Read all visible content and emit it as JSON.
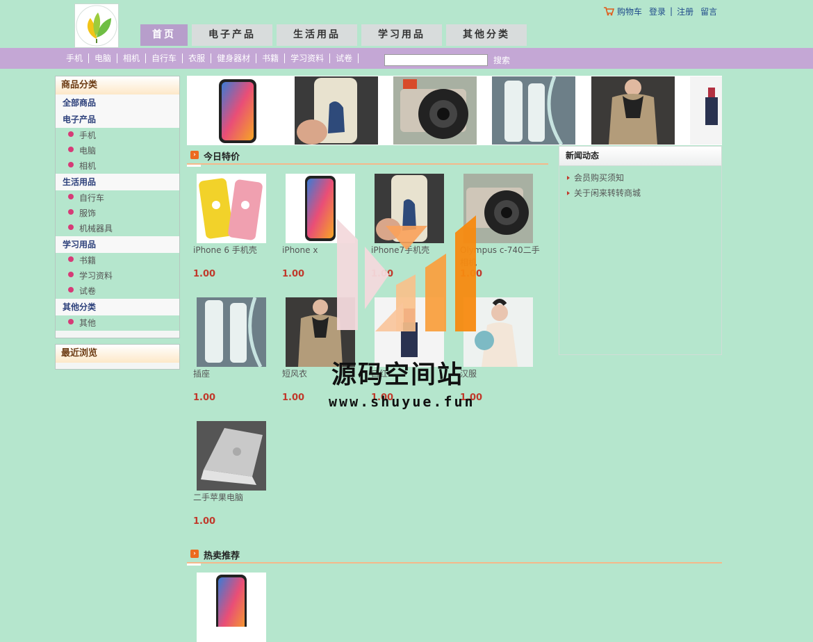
{
  "header": {
    "cart_label": "购物车",
    "login_label": "登录",
    "separator": "|",
    "register_label": "注册",
    "message_label": "留言"
  },
  "main_nav": {
    "tabs": [
      {
        "label": "首页",
        "active": true
      },
      {
        "label": "电子产品"
      },
      {
        "label": "生活用品"
      },
      {
        "label": "学习用品"
      },
      {
        "label": "其他分类"
      }
    ]
  },
  "sub_nav": {
    "items": [
      "手机",
      "电脑",
      "相机",
      "自行车",
      "衣服",
      "健身器材",
      "书籍",
      "学习资料",
      "试卷"
    ],
    "search_value": "",
    "search_button": "搜索"
  },
  "sidebar": {
    "title": "商品分类",
    "all_label": "全部商品",
    "groups": [
      {
        "name": "电子产品",
        "items": [
          "手机",
          "电脑",
          "相机"
        ]
      },
      {
        "name": "生活用品",
        "items": [
          "自行车",
          "服饰",
          "机械器具"
        ]
      },
      {
        "name": "学习用品",
        "items": [
          "书籍",
          "学习资料",
          "试卷"
        ]
      },
      {
        "name": "其他分类",
        "items": [
          "其他"
        ]
      }
    ],
    "recent_title": "最近浏览"
  },
  "specials": {
    "title": "今日特价",
    "products": [
      {
        "name": "iPhone 6 手机壳",
        "price": "1.00"
      },
      {
        "name": "iPhone x",
        "price": "1.00"
      },
      {
        "name": "iPhone7手机壳",
        "price": "1.00"
      },
      {
        "name": "Olympus c-740二手相机",
        "price": "1.00"
      },
      {
        "name": "插座",
        "price": "1.00"
      },
      {
        "name": "短风衣",
        "price": "1.00"
      },
      {
        "name": "口红",
        "price": "1.00"
      },
      {
        "name": "汉服",
        "price": "1.00"
      },
      {
        "name": "二手苹果电脑",
        "price": "1.00"
      }
    ]
  },
  "news": {
    "title": "新闻动态",
    "items": [
      "会员购买须知",
      "关于闲来转转商城"
    ]
  },
  "hot": {
    "title": "热卖推荐"
  },
  "watermark": {
    "text": "源码空间站",
    "url": "www.shuyue.fun"
  },
  "colors": {
    "page_bg": "#b5e6cd",
    "subnav_bg": "#c4a7d5",
    "active_tab": "#b79ecb",
    "price": "#c0392b"
  }
}
